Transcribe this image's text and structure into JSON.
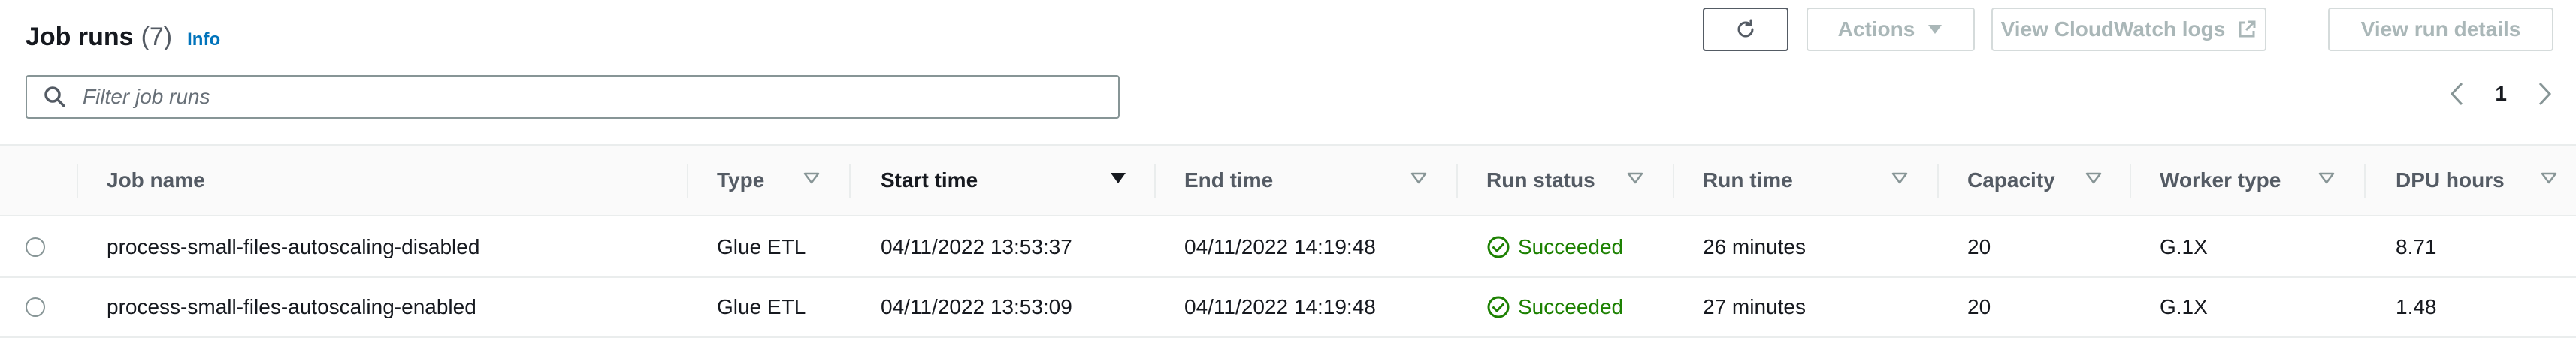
{
  "header": {
    "title": "Job runs",
    "count": "(7)",
    "info": "Info"
  },
  "toolbar": {
    "actions_label": "Actions",
    "cloudwatch_label": "View CloudWatch logs",
    "run_details_label": "View run details"
  },
  "search": {
    "placeholder": "Filter job runs",
    "value": ""
  },
  "pagination": {
    "current_page": "1"
  },
  "columns": [
    "Job name",
    "Type",
    "Start time",
    "End time",
    "Run status",
    "Run time",
    "Capacity",
    "Worker type",
    "DPU hours"
  ],
  "sorted_column": "Start time",
  "rows": [
    {
      "job_name": "process-small-files-autoscaling-disabled",
      "type": "Glue ETL",
      "start_time": "04/11/2022 13:53:37",
      "end_time": "04/11/2022 14:19:48",
      "run_status": "Succeeded",
      "run_time": "26 minutes",
      "capacity": "20",
      "worker_type": "G.1X",
      "dpu_hours": "8.71"
    },
    {
      "job_name": "process-small-files-autoscaling-enabled",
      "type": "Glue ETL",
      "start_time": "04/11/2022 13:53:09",
      "end_time": "04/11/2022 14:19:48",
      "run_status": "Succeeded",
      "run_time": "27 minutes",
      "capacity": "20",
      "worker_type": "G.1X",
      "dpu_hours": "1.48"
    }
  ],
  "icons": {
    "refresh": "refresh-icon",
    "dropdown": "caret-down-icon",
    "external": "external-link-icon",
    "search": "search-icon",
    "prev": "chevron-left-icon",
    "next": "chevron-right-icon",
    "success": "check-circle-icon"
  },
  "colors": {
    "success": "#1d8102",
    "link": "#0073bb",
    "disabled": "#aab7b8"
  }
}
